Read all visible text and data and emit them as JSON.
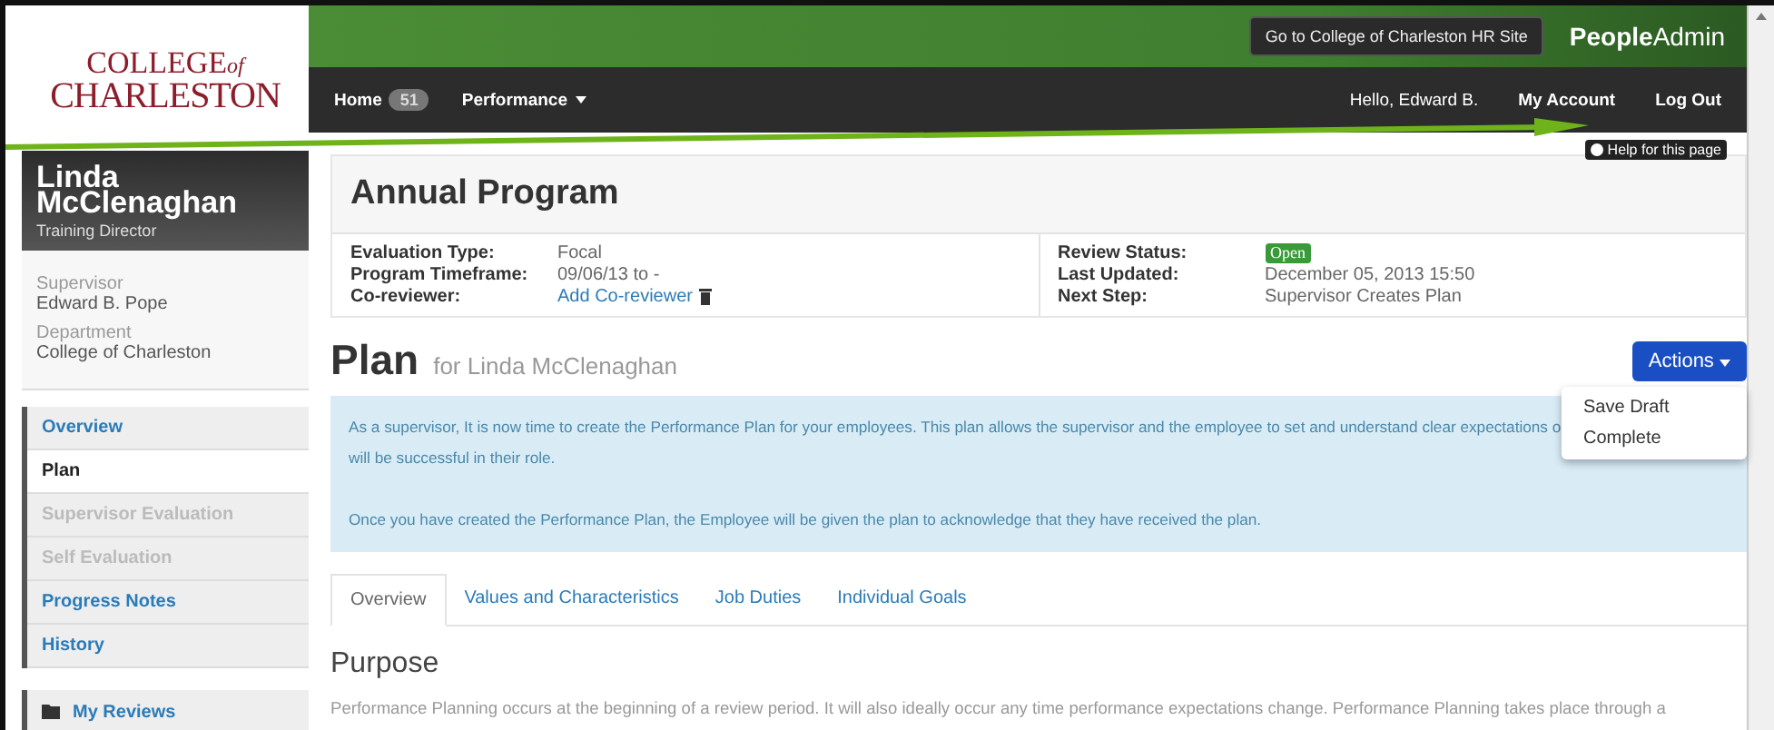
{
  "header": {
    "logo_line1": "COLLEGE",
    "logo_of": "of",
    "logo_line2": "CHARLESTON",
    "hr_button": "Go to College of Charleston HR Site",
    "brand_bold": "People",
    "brand_rest": "Admin",
    "nav": [
      {
        "label": "Home",
        "badge": "51",
        "caret": false
      },
      {
        "label": "Performance",
        "caret": true
      }
    ],
    "hello": "Hello, Edward B.",
    "account": "My Account",
    "logout": "Log Out",
    "help": "Help for this page"
  },
  "profile": {
    "first": "Linda",
    "last": "McClenaghan",
    "title": "Training Director",
    "fields": [
      {
        "label": "Supervisor",
        "value": "Edward B. Pope"
      },
      {
        "label": "Department",
        "value": "College of Charleston"
      }
    ]
  },
  "sidebar": {
    "items": [
      {
        "label": "Overview",
        "selected": false,
        "disabled": false
      },
      {
        "label": "Plan",
        "selected": true,
        "disabled": false
      },
      {
        "label": "Supervisor Evaluation",
        "selected": false,
        "disabled": true
      },
      {
        "label": "Self Evaluation",
        "selected": false,
        "disabled": true
      },
      {
        "label": "Progress Notes",
        "selected": false,
        "disabled": false
      },
      {
        "label": "History",
        "selected": false,
        "disabled": false
      }
    ],
    "my_reviews": "My Reviews"
  },
  "program": {
    "title": "Annual Program",
    "left": [
      {
        "label": "Evaluation Type:",
        "value": "Focal",
        "kind": "text"
      },
      {
        "label": "Program Timeframe:",
        "value": "09/06/13 to -",
        "kind": "text"
      },
      {
        "label": "Co-reviewer:",
        "value": "Add Co-reviewer",
        "kind": "link"
      }
    ],
    "right": [
      {
        "label": "Review Status:",
        "value": "Open",
        "kind": "badge"
      },
      {
        "label": "Last Updated:",
        "value": "December 05, 2013 15:50",
        "kind": "text"
      },
      {
        "label": "Next Step:",
        "value": "Supervisor Creates Plan",
        "kind": "text"
      }
    ]
  },
  "plan": {
    "title": "Plan",
    "subtitle": "for Linda McClenaghan",
    "actions": "Actions",
    "menu": [
      "Save Draft",
      "Complete"
    ],
    "info_line1": "As a supervisor, It is now time to create the Performance Plan for your employees. This plan allows the supervisor and the employee to set and understand clear expectations o",
    "info_line2": "will be successful in their role.",
    "info_para2": "Once you have created the Performance Plan, the Employee will be given the plan to acknowledge that they have received the plan.",
    "tabs": [
      {
        "label": "Overview",
        "selected": true
      },
      {
        "label": "Values and Characteristics",
        "selected": false
      },
      {
        "label": "Job Duties",
        "selected": false
      },
      {
        "label": "Individual Goals",
        "selected": false
      }
    ],
    "section": "Purpose",
    "body": "Performance Planning occurs at the beginning of a review period. It will also ideally occur any time performance expectations change. Performance Planning takes place through a"
  }
}
